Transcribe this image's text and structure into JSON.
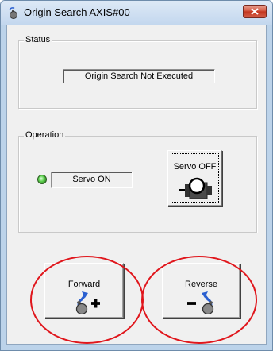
{
  "window": {
    "title": "Origin Search AXIS#00",
    "close_icon": "close-x-icon",
    "title_icon": "motor-icon"
  },
  "status_group": {
    "title": "Status",
    "status_text": "Origin Search Not Executed"
  },
  "operation_group": {
    "title": "Operation",
    "servo_led_color": "#5fd24f",
    "servo_status_text": "Servo ON",
    "servo_button_label": "Servo OFF",
    "servo_button_icon": "servo-motor-icon"
  },
  "buttons": {
    "forward_label": "Forward",
    "forward_icon": "forward-rotation-icon",
    "reverse_label": "Reverse",
    "reverse_icon": "reverse-rotation-icon"
  },
  "colors": {
    "highlight": "#e0161c",
    "arrow_blue": "#2a5fd0"
  }
}
